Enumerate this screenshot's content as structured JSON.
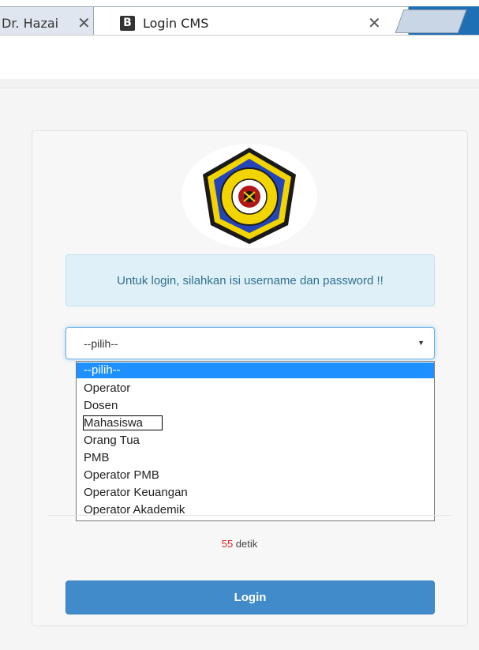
{
  "browser": {
    "tab_inactive_title": "Dr. Hazai",
    "tab_active_title": "Login CMS",
    "favicon_letter": "B",
    "close_glyph": "✕"
  },
  "login": {
    "notice": "Untuk login, silahkan isi username dan password !!",
    "select": {
      "value": "--pilih--",
      "options": [
        "--pilih--",
        "Operator",
        "Dosen",
        "Mahasiswa",
        "Orang Tua",
        "PMB",
        "Operator PMB",
        "Operator Keuangan",
        "Operator Akademik"
      ],
      "highlighted_index": 0,
      "focused_option": "Mahasiswa"
    },
    "timer": {
      "seconds": "55",
      "unit": " detik"
    },
    "button_label": "Login"
  },
  "icons": {
    "logo": "university-logo-icon",
    "caret": "caret-down-icon"
  },
  "colors": {
    "primary": "#428bca",
    "alert_bg": "#dff0f8",
    "alert_text": "#31708f",
    "option_selected": "#1e90ff",
    "timer_number": "#e02020",
    "tab_strip": "#1f6fb5"
  }
}
